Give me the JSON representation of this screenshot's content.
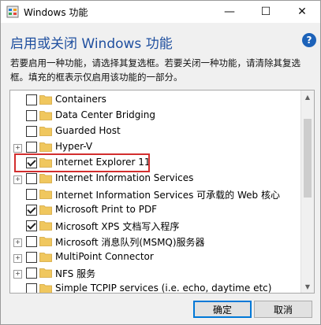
{
  "window": {
    "title": "Windows 功能",
    "heading": "启用或关闭 Windows 功能",
    "help_label": "?",
    "description": "若要启用一种功能，请选择其复选框。若要关闭一种功能，请清除其复选框。填充的框表示仅启用该功能的一部分。",
    "controls": {
      "minimize": "—",
      "maximize": "☐",
      "close": "✕"
    }
  },
  "features": [
    {
      "label": "Containers",
      "expandable": false,
      "checked": false
    },
    {
      "label": "Data Center Bridging",
      "expandable": false,
      "checked": false
    },
    {
      "label": "Guarded Host",
      "expandable": false,
      "checked": false
    },
    {
      "label": "Hyper-V",
      "expandable": true,
      "checked": false
    },
    {
      "label": "Internet Explorer 11",
      "expandable": false,
      "checked": true
    },
    {
      "label": "Internet Information Services",
      "expandable": true,
      "checked": false
    },
    {
      "label": "Internet Information Services 可承载的 Web 核心",
      "expandable": false,
      "checked": false
    },
    {
      "label": "Microsoft Print to PDF",
      "expandable": false,
      "checked": true
    },
    {
      "label": "Microsoft XPS 文档写入程序",
      "expandable": false,
      "checked": true
    },
    {
      "label": "Microsoft 消息队列(MSMQ)服务器",
      "expandable": true,
      "checked": false
    },
    {
      "label": "MultiPoint Connector",
      "expandable": true,
      "checked": false
    },
    {
      "label": "NFS 服务",
      "expandable": true,
      "checked": false
    },
    {
      "label": "Simple TCPIP services (i.e. echo, daytime etc)",
      "expandable": false,
      "checked": false
    }
  ],
  "buttons": {
    "ok": "确定",
    "cancel": "取消"
  },
  "colors": {
    "heading": "#1f4f9f",
    "highlight": "#d22e2e",
    "folder": "#f0c75e",
    "accent": "#0078d7"
  }
}
